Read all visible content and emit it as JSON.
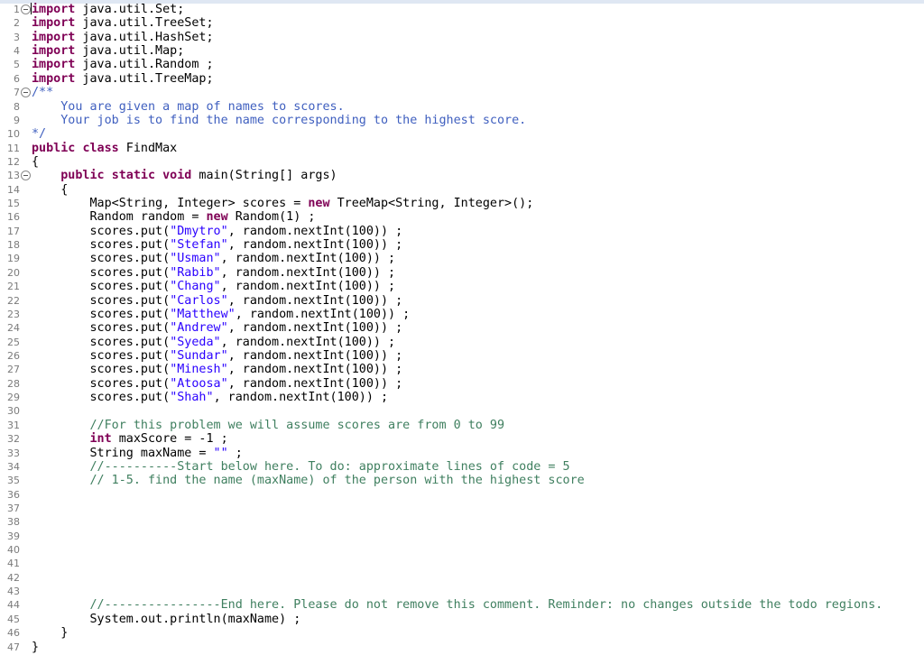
{
  "editor": {
    "language": "java",
    "fold_lines": [
      1,
      7,
      13
    ],
    "caret_line": 1,
    "lines": [
      [
        [
          "kw",
          "import"
        ],
        [
          "p",
          " java.util.Set;"
        ]
      ],
      [
        [
          "kw",
          "import"
        ],
        [
          "p",
          " java.util.TreeSet;"
        ]
      ],
      [
        [
          "kw",
          "import"
        ],
        [
          "p",
          " java.util.HashSet;"
        ]
      ],
      [
        [
          "kw",
          "import"
        ],
        [
          "p",
          " java.util.Map;"
        ]
      ],
      [
        [
          "kw",
          "import"
        ],
        [
          "p",
          " java.util.Random ;"
        ]
      ],
      [
        [
          "kw",
          "import"
        ],
        [
          "p",
          " java.util.TreeMap;"
        ]
      ],
      [
        [
          "doc",
          "/**"
        ]
      ],
      [
        [
          "doc",
          "    You are given a map of names to scores."
        ]
      ],
      [
        [
          "doc",
          "    Your job is to find the name corresponding to the highest score."
        ]
      ],
      [
        [
          "doc",
          "*/"
        ]
      ],
      [
        [
          "kw",
          "public"
        ],
        [
          "p",
          " "
        ],
        [
          "kw",
          "class"
        ],
        [
          "p",
          " FindMax"
        ]
      ],
      [
        [
          "p",
          "{"
        ]
      ],
      [
        [
          "p",
          "    "
        ],
        [
          "kw",
          "public"
        ],
        [
          "p",
          " "
        ],
        [
          "kw",
          "static"
        ],
        [
          "p",
          " "
        ],
        [
          "kw",
          "void"
        ],
        [
          "p",
          " main(String[] args)"
        ]
      ],
      [
        [
          "p",
          "    {"
        ]
      ],
      [
        [
          "p",
          "        Map<String, Integer> scores = "
        ],
        [
          "kw",
          "new"
        ],
        [
          "p",
          " TreeMap<String, Integer>();"
        ]
      ],
      [
        [
          "p",
          "        Random random = "
        ],
        [
          "kw",
          "new"
        ],
        [
          "p",
          " Random(1) ;"
        ]
      ],
      [
        [
          "p",
          "        scores.put("
        ],
        [
          "str",
          "\"Dmytro\""
        ],
        [
          "p",
          ", random.nextInt(100)) ;"
        ]
      ],
      [
        [
          "p",
          "        scores.put("
        ],
        [
          "str",
          "\"Stefan\""
        ],
        [
          "p",
          ", random.nextInt(100)) ;"
        ]
      ],
      [
        [
          "p",
          "        scores.put("
        ],
        [
          "str",
          "\"Usman\""
        ],
        [
          "p",
          ", random.nextInt(100)) ;"
        ]
      ],
      [
        [
          "p",
          "        scores.put("
        ],
        [
          "str",
          "\"Rabib\""
        ],
        [
          "p",
          ", random.nextInt(100)) ;"
        ]
      ],
      [
        [
          "p",
          "        scores.put("
        ],
        [
          "str",
          "\"Chang\""
        ],
        [
          "p",
          ", random.nextInt(100)) ;"
        ]
      ],
      [
        [
          "p",
          "        scores.put("
        ],
        [
          "str",
          "\"Carlos\""
        ],
        [
          "p",
          ", random.nextInt(100)) ;"
        ]
      ],
      [
        [
          "p",
          "        scores.put("
        ],
        [
          "str",
          "\"Matthew\""
        ],
        [
          "p",
          ", random.nextInt(100)) ;"
        ]
      ],
      [
        [
          "p",
          "        scores.put("
        ],
        [
          "str",
          "\"Andrew\""
        ],
        [
          "p",
          ", random.nextInt(100)) ;"
        ]
      ],
      [
        [
          "p",
          "        scores.put("
        ],
        [
          "str",
          "\"Syeda\""
        ],
        [
          "p",
          ", random.nextInt(100)) ;"
        ]
      ],
      [
        [
          "p",
          "        scores.put("
        ],
        [
          "str",
          "\"Sundar\""
        ],
        [
          "p",
          ", random.nextInt(100)) ;"
        ]
      ],
      [
        [
          "p",
          "        scores.put("
        ],
        [
          "str",
          "\"Minesh\""
        ],
        [
          "p",
          ", random.nextInt(100)) ;"
        ]
      ],
      [
        [
          "p",
          "        scores.put("
        ],
        [
          "str",
          "\"Atoosa\""
        ],
        [
          "p",
          ", random.nextInt(100)) ;"
        ]
      ],
      [
        [
          "p",
          "        scores.put("
        ],
        [
          "str",
          "\"Shah\""
        ],
        [
          "p",
          ", random.nextInt(100)) ;"
        ]
      ],
      [],
      [
        [
          "p",
          "        "
        ],
        [
          "cm",
          "//For this problem we will assume scores are from 0 to 99"
        ]
      ],
      [
        [
          "p",
          "        "
        ],
        [
          "kw",
          "int"
        ],
        [
          "p",
          " maxScore = -1 ;"
        ]
      ],
      [
        [
          "p",
          "        String maxName = "
        ],
        [
          "str",
          "\"\""
        ],
        [
          "p",
          " ;"
        ]
      ],
      [
        [
          "p",
          "        "
        ],
        [
          "cm",
          "//----------Start below here. To do: approximate lines of code = 5"
        ]
      ],
      [
        [
          "p",
          "        "
        ],
        [
          "cm",
          "// 1-5. find the name (maxName) of the person with the highest score"
        ]
      ],
      [],
      [],
      [],
      [],
      [],
      [],
      [],
      [],
      [
        [
          "p",
          "        "
        ],
        [
          "cm",
          "//----------------End here. Please do not remove this comment. Reminder: no changes outside the todo regions."
        ]
      ],
      [
        [
          "p",
          "        System.out.println(maxName) ;"
        ]
      ],
      [
        [
          "p",
          "    }"
        ]
      ],
      [
        [
          "p",
          "}"
        ]
      ]
    ]
  }
}
